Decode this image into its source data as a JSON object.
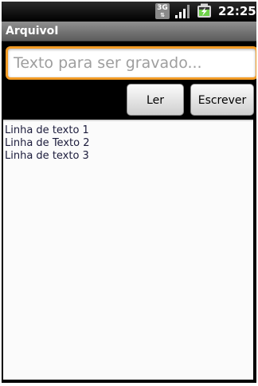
{
  "status_bar": {
    "network_label": "3G",
    "network_icon": "3g-data-icon",
    "signal_icon": "signal-strength-icon",
    "battery_icon": "battery-charging-icon",
    "time": "22:25"
  },
  "app": {
    "title": "ArquivoI"
  },
  "input": {
    "value": "",
    "placeholder": "Texto para ser gravado..."
  },
  "buttons": {
    "read_label": "Ler",
    "write_label": "Escrever"
  },
  "content": {
    "lines": [
      "Linha de texto 1",
      "Linha de Texto 2",
      "Linha de texto 3"
    ]
  },
  "colors": {
    "focus_border": "#f39c26",
    "title_bar": "#7a7a7a",
    "battery_green": "#6fd14a"
  }
}
